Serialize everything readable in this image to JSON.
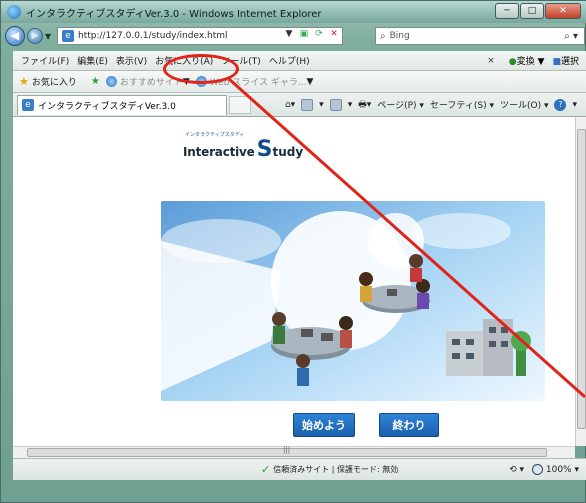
{
  "window": {
    "title": "インタラクティブスタディVer.3.0 - Windows Internet Explorer",
    "minimize": "─",
    "maximize": "□",
    "close": "✕"
  },
  "address": {
    "url": "http://127.0.0.1/study/index.html",
    "search_placeholder": "Bing"
  },
  "menu": {
    "items": [
      "ファイル(F)",
      "編集(E)",
      "表示(V)",
      "お気に入り(A)",
      "ツール(T)",
      "ヘルプ(H)"
    ],
    "right": [
      "変換",
      "選択"
    ]
  },
  "favorites": {
    "label": "お気に入り",
    "suggested": "おすすめサイト",
    "webslice": "Web スライス ギャラ..."
  },
  "tab": {
    "label": "インタラクティブスタディVer.3.0"
  },
  "commands": {
    "page": "ページ(P)",
    "safety": "セーフティ(S)",
    "tools": "ツール(O)"
  },
  "content": {
    "logo_small": "インタラクティブスタディ",
    "logo_main_a": "Interactive",
    "logo_main_s": "S",
    "logo_main_b": "tudy",
    "start_button": "始めよう",
    "end_button": "終わり"
  },
  "status": {
    "text": "信頼済みサイト | 保護モード: 無効",
    "zoom": "100%"
  },
  "colors": {
    "accent_button": "#1f6cc0",
    "callout": "#e2231a"
  }
}
